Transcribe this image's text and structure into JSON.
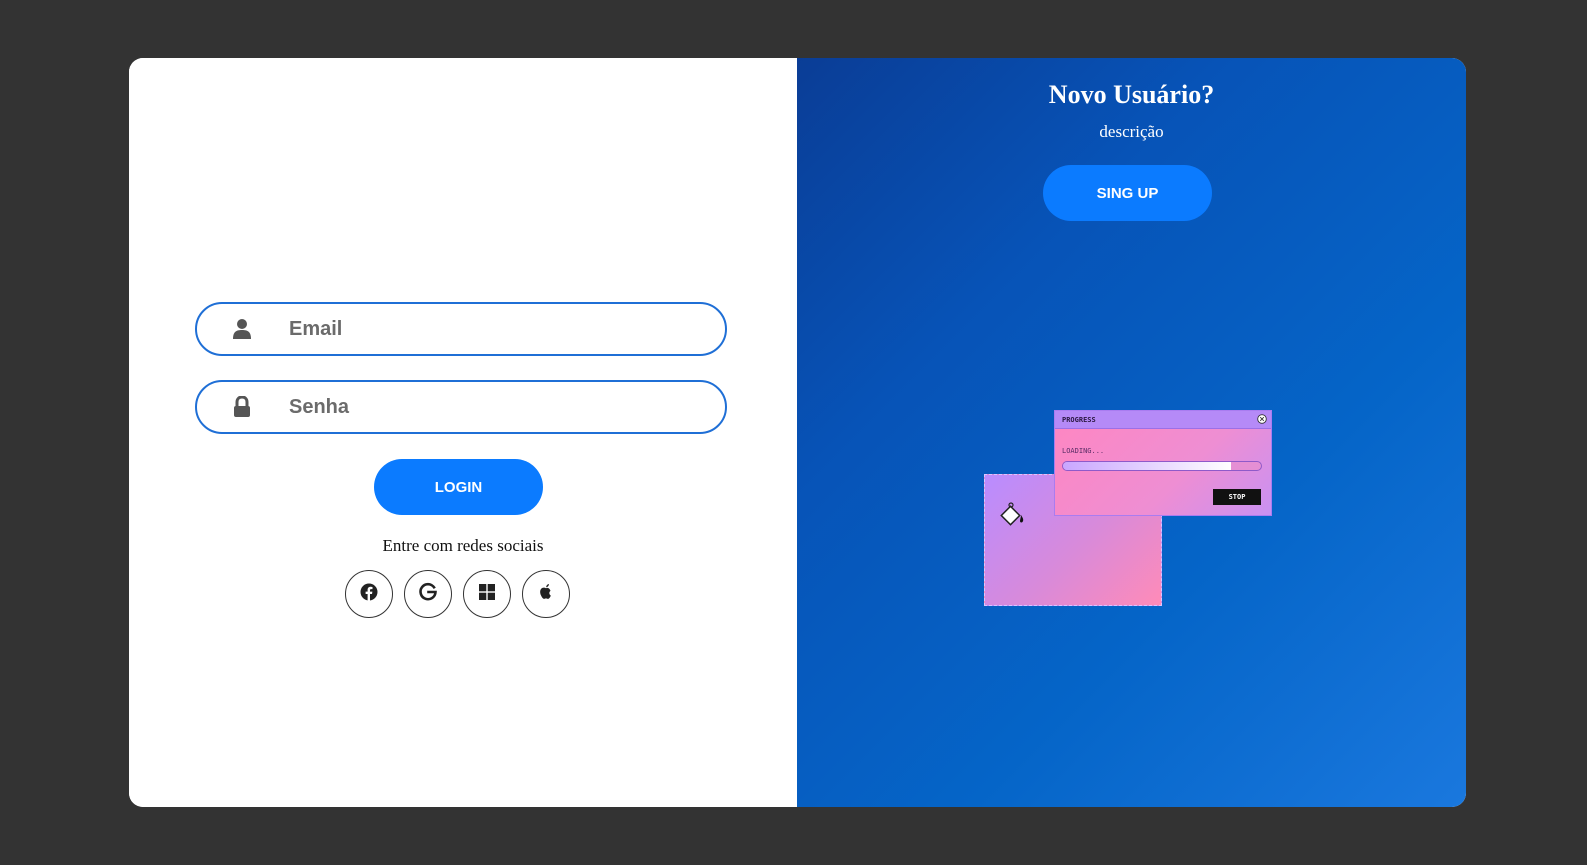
{
  "login": {
    "email_placeholder": "Email",
    "password_placeholder": "Senha",
    "login_label": "LOGIN",
    "social_text": "Entre com redes sociais",
    "social_icons": [
      "facebook-icon",
      "google-icon",
      "windows-icon",
      "apple-icon"
    ]
  },
  "signup": {
    "title": "Novo Usuário?",
    "description": "descrição",
    "button_label": "SING UP"
  },
  "illustration": {
    "window_title": "PROGRESS",
    "loading_text": "LOADING...",
    "progress": 0.85,
    "stop_label": "STOP"
  },
  "colors": {
    "page_bg": "#333333",
    "accent": "#0b7bff",
    "field_border": "#1f6fd6",
    "panel_gradient_start": "#0a3d96",
    "panel_gradient_end": "#1a78de"
  }
}
